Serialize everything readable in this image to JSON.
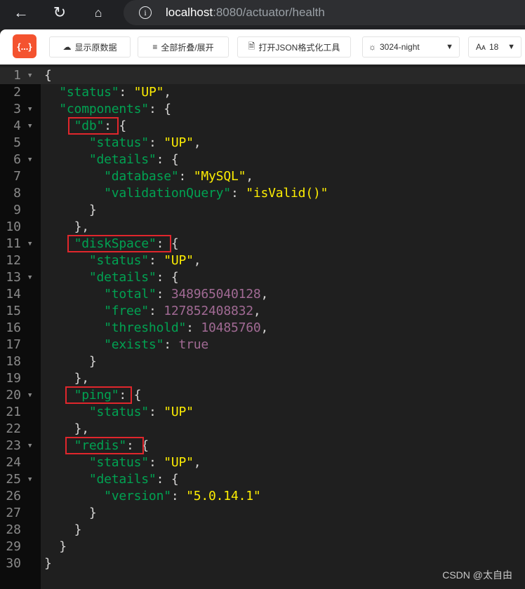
{
  "browser": {
    "url_host": "localhost",
    "url_path": ":8080/actuator/health",
    "icons": [
      "back-arrow-icon",
      "reload-icon",
      "home-icon",
      "info-icon"
    ]
  },
  "toolbar": {
    "logo": "{...}",
    "show_raw": "显示原数据",
    "collapse_all": "全部折叠/展开",
    "open_formatter": "打开JSON格式化工具",
    "theme": "3024-night",
    "font_size": "18"
  },
  "colors": {
    "key": "#01a252",
    "string": "#fded02",
    "number": "#a16a94",
    "highlight_box": "#e0262c"
  },
  "lines": [
    {
      "i": 0,
      "f": true,
      "t": [
        [
          "p",
          "{"
        ]
      ]
    },
    {
      "i": 1,
      "t": [
        [
          "k",
          "\"status\""
        ],
        [
          "p",
          ": "
        ],
        [
          "s",
          "\"UP\""
        ],
        [
          "p",
          ","
        ]
      ]
    },
    {
      "i": 1,
      "f": true,
      "t": [
        [
          "k",
          "\"components\""
        ],
        [
          "p",
          ": {"
        ]
      ]
    },
    {
      "i": 2,
      "f": true,
      "t": [
        [
          "k",
          "\"db\""
        ],
        [
          "p",
          ": {"
        ]
      ]
    },
    {
      "i": 3,
      "t": [
        [
          "k",
          "\"status\""
        ],
        [
          "p",
          ": "
        ],
        [
          "s",
          "\"UP\""
        ],
        [
          "p",
          ","
        ]
      ]
    },
    {
      "i": 3,
      "f": true,
      "t": [
        [
          "k",
          "\"details\""
        ],
        [
          "p",
          ": {"
        ]
      ]
    },
    {
      "i": 4,
      "t": [
        [
          "k",
          "\"database\""
        ],
        [
          "p",
          ": "
        ],
        [
          "s",
          "\"MySQL\""
        ],
        [
          "p",
          ","
        ]
      ]
    },
    {
      "i": 4,
      "t": [
        [
          "k",
          "\"validationQuery\""
        ],
        [
          "p",
          ": "
        ],
        [
          "s",
          "\"isValid()\""
        ]
      ]
    },
    {
      "i": 3,
      "t": [
        [
          "p",
          "}"
        ]
      ]
    },
    {
      "i": 2,
      "t": [
        [
          "p",
          "},"
        ]
      ]
    },
    {
      "i": 2,
      "f": true,
      "t": [
        [
          "k",
          "\"diskSpace\""
        ],
        [
          "p",
          ": {"
        ]
      ]
    },
    {
      "i": 3,
      "t": [
        [
          "k",
          "\"status\""
        ],
        [
          "p",
          ": "
        ],
        [
          "s",
          "\"UP\""
        ],
        [
          "p",
          ","
        ]
      ]
    },
    {
      "i": 3,
      "f": true,
      "t": [
        [
          "k",
          "\"details\""
        ],
        [
          "p",
          ": {"
        ]
      ]
    },
    {
      "i": 4,
      "t": [
        [
          "k",
          "\"total\""
        ],
        [
          "p",
          ": "
        ],
        [
          "n",
          "348965040128"
        ],
        [
          "p",
          ","
        ]
      ]
    },
    {
      "i": 4,
      "t": [
        [
          "k",
          "\"free\""
        ],
        [
          "p",
          ": "
        ],
        [
          "n",
          "127852408832"
        ],
        [
          "p",
          ","
        ]
      ]
    },
    {
      "i": 4,
      "t": [
        [
          "k",
          "\"threshold\""
        ],
        [
          "p",
          ": "
        ],
        [
          "n",
          "10485760"
        ],
        [
          "p",
          ","
        ]
      ]
    },
    {
      "i": 4,
      "t": [
        [
          "k",
          "\"exists\""
        ],
        [
          "p",
          ": "
        ],
        [
          "n",
          "true"
        ]
      ]
    },
    {
      "i": 3,
      "t": [
        [
          "p",
          "}"
        ]
      ]
    },
    {
      "i": 2,
      "t": [
        [
          "p",
          "},"
        ]
      ]
    },
    {
      "i": 2,
      "f": true,
      "t": [
        [
          "k",
          "\"ping\""
        ],
        [
          "p",
          ": {"
        ]
      ]
    },
    {
      "i": 3,
      "t": [
        [
          "k",
          "\"status\""
        ],
        [
          "p",
          ": "
        ],
        [
          "s",
          "\"UP\""
        ]
      ]
    },
    {
      "i": 2,
      "t": [
        [
          "p",
          "},"
        ]
      ]
    },
    {
      "i": 2,
      "f": true,
      "t": [
        [
          "k",
          "\"redis\""
        ],
        [
          "p",
          ": {"
        ]
      ]
    },
    {
      "i": 3,
      "t": [
        [
          "k",
          "\"status\""
        ],
        [
          "p",
          ": "
        ],
        [
          "s",
          "\"UP\""
        ],
        [
          "p",
          ","
        ]
      ]
    },
    {
      "i": 3,
      "f": true,
      "t": [
        [
          "k",
          "\"details\""
        ],
        [
          "p",
          ": {"
        ]
      ]
    },
    {
      "i": 4,
      "t": [
        [
          "k",
          "\"version\""
        ],
        [
          "p",
          ": "
        ],
        [
          "s",
          "\"5.0.14.1\""
        ]
      ]
    },
    {
      "i": 3,
      "t": [
        [
          "p",
          "}"
        ]
      ]
    },
    {
      "i": 2,
      "t": [
        [
          "p",
          "}"
        ]
      ]
    },
    {
      "i": 1,
      "t": [
        [
          "p",
          "}"
        ]
      ]
    },
    {
      "i": 0,
      "t": [
        [
          "p",
          "}"
        ]
      ]
    }
  ],
  "watermark": "CSDN @太自由"
}
